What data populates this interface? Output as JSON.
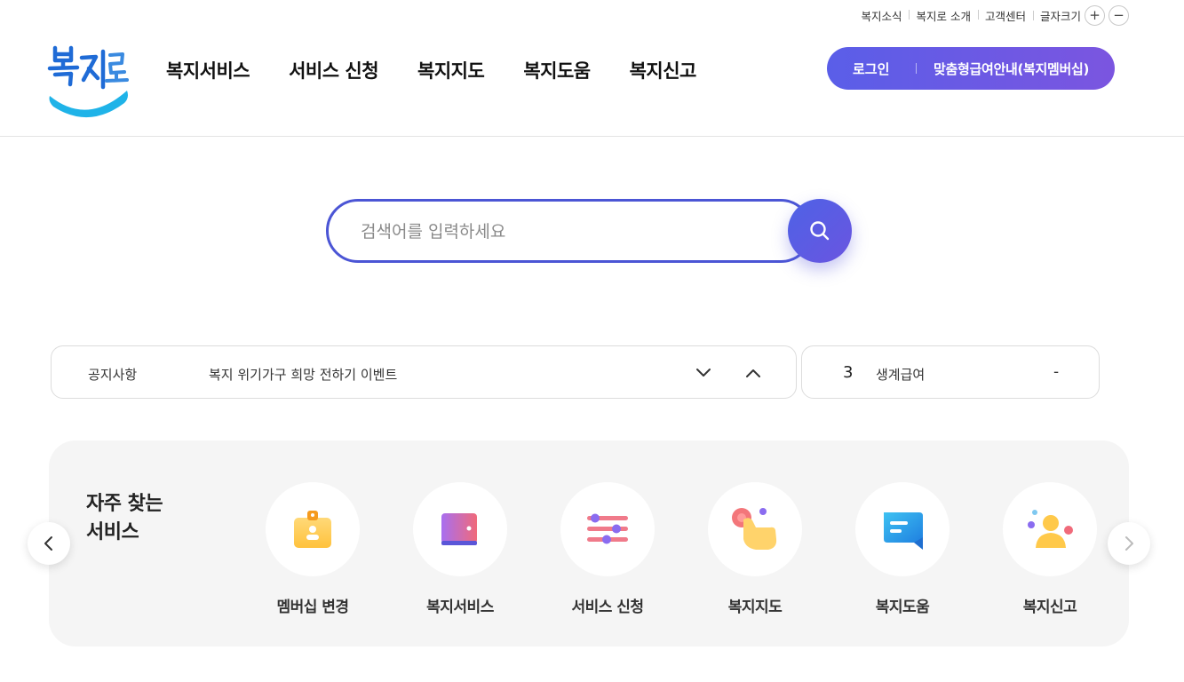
{
  "util": {
    "news": "복지소식",
    "about": "복지로 소개",
    "support": "고객센터",
    "font_size": "글자크기",
    "plus": "+",
    "minus": "−"
  },
  "gnb": [
    "복지서비스",
    "서비스 신청",
    "복지지도",
    "복지도움",
    "복지신고"
  ],
  "userbox": {
    "login": "로그인",
    "member": "맞춤형급여안내(복지멤버십)"
  },
  "search": {
    "placeholder": "검색어를 입력하세요"
  },
  "notice": {
    "label": "공지사항",
    "text": "복지 위기가구 희망 전하기 이벤트"
  },
  "rank": {
    "num": "3",
    "keyword": "생계급여",
    "change": "-"
  },
  "freq": {
    "title_line1": "자주 찾는",
    "title_line2": "서비스",
    "items": [
      "멤버십 변경",
      "복지서비스",
      "서비스 신청",
      "복지지도",
      "복지도움",
      "복지신고"
    ]
  },
  "colors": {
    "accent": "#4b55d5",
    "brand_blue": "#1fb3e8"
  },
  "icons": [
    "plus-icon",
    "minus-icon",
    "search-icon",
    "chevron-down-icon",
    "chevron-up-icon",
    "chevron-left-icon",
    "chevron-right-icon",
    "badge-icon",
    "wallet-icon",
    "sliders-icon",
    "pointer-icon",
    "chat-icon",
    "person-icon"
  ]
}
